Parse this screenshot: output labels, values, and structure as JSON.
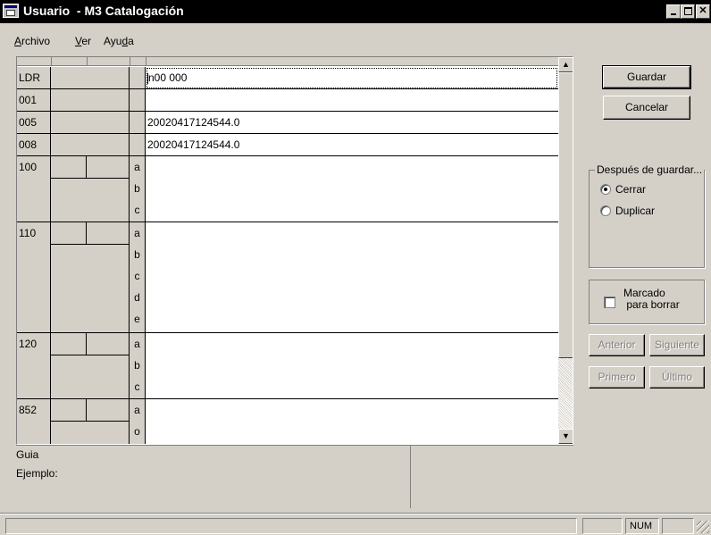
{
  "window": {
    "title": "Usuario  - M3 Catalogación",
    "icon": "catalog-app-icon"
  },
  "menu": {
    "items": [
      {
        "pre": "",
        "key": "A",
        "post": "rchivo"
      },
      {
        "pre": "",
        "key": "V",
        "post": "er"
      },
      {
        "pre": "Ayu",
        "key": "d",
        "post": "a"
      }
    ]
  },
  "grid": {
    "leader": {
      "tag": "LDR",
      "value": "n00  000"
    },
    "f001": {
      "tag": "001",
      "value": ""
    },
    "f005": {
      "tag": "005",
      "value": "20020417124544.0"
    },
    "f008": {
      "tag": "008",
      "value": "20020417124544.0"
    },
    "f100": {
      "tag": "100",
      "subfields": [
        "a",
        "b",
        "c"
      ]
    },
    "f110": {
      "tag": "110",
      "subfields": [
        "a",
        "b",
        "c",
        "d",
        "e"
      ]
    },
    "f120": {
      "tag": "120",
      "subfields": [
        "a",
        "b",
        "c"
      ]
    },
    "f852": {
      "tag": "852",
      "subfields": [
        "a",
        "o"
      ]
    }
  },
  "guide": {
    "guia_label": "Guia",
    "ejemplo_label": "Ejemplo:"
  },
  "buttons": {
    "guardar": "Guardar",
    "cancelar": "Cancelar",
    "anterior": "Anterior",
    "siguiente": "Siguiente",
    "primero": "Primero",
    "ultimo": "Último"
  },
  "after_save": {
    "legend": "Después de guardar...",
    "options": [
      "Cerrar",
      "Duplicar"
    ],
    "selected": "Cerrar"
  },
  "mark_delete": {
    "label": "Marcado\n para borrar",
    "checked": false
  },
  "status": {
    "num": "NUM"
  }
}
